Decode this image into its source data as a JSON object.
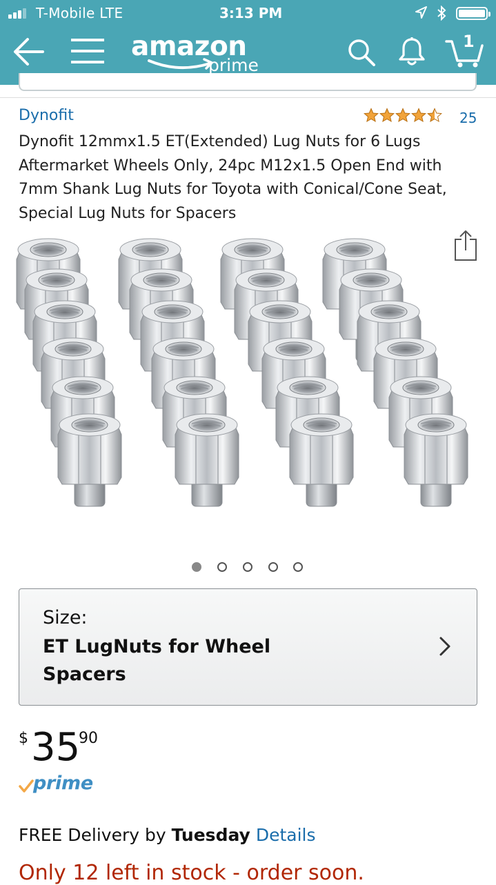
{
  "status_bar": {
    "carrier": "T-Mobile  LTE",
    "time": "3:13 PM"
  },
  "header": {
    "logo_word": "amazon",
    "logo_sub": "prime",
    "cart_count": "1",
    "bar_color": "#4aa6b5"
  },
  "product": {
    "brand": "Dynofit",
    "rating_stars": 4.5,
    "review_count": "25",
    "title": "Dynofit 12mmx1.5 ET(Extended) Lug Nuts for 6 Lugs Aftermarket Wheels Only, 24pc M12x1.5 Open End with 7mm Shank Lug Nuts for Toyota with Conical/Cone Seat, Special Lug Nuts for Spacers",
    "image_count": 5,
    "image_active_index": 0
  },
  "size_selector": {
    "label": "Size:",
    "value": "ET LugNuts for Wheel Spacers"
  },
  "price": {
    "currency": "$",
    "whole": "35",
    "fraction": "90"
  },
  "prime_badge": {
    "text": "prime",
    "check_color": "#f3a847"
  },
  "delivery": {
    "prefix": "FREE Delivery by ",
    "day": "Tuesday",
    "link": "Details"
  },
  "stock": {
    "text": "Only 12 left in stock - order soon.",
    "color": "#b12704"
  }
}
